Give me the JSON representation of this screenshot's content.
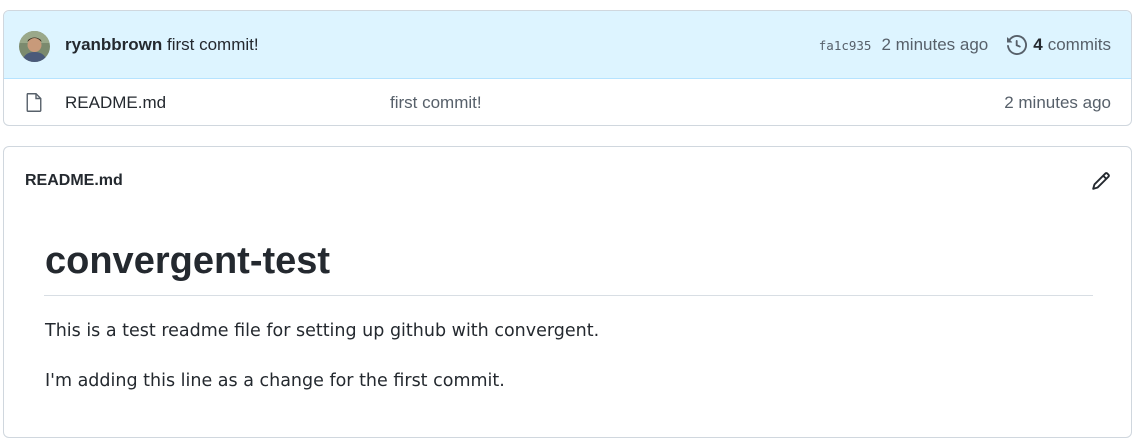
{
  "latest_commit": {
    "author": "ryanbbrown",
    "message": "first commit!",
    "sha": "fa1c935",
    "time": "2 minutes ago",
    "commit_count": "4",
    "commits_label": "commits"
  },
  "files": [
    {
      "icon": "file-icon",
      "name": "README.md",
      "commit_message": "first commit!",
      "age": "2 minutes ago"
    }
  ],
  "readme": {
    "filename": "README.md",
    "title": "convergent-test",
    "paragraphs": [
      "This is a test readme file for setting up github with convergent.",
      "I'm adding this line as a change for the first commit."
    ]
  },
  "colors": {
    "commit_bar_bg": "#ddf4ff",
    "border": "#d0d7de",
    "muted_text": "#57606a",
    "text": "#24292f"
  }
}
